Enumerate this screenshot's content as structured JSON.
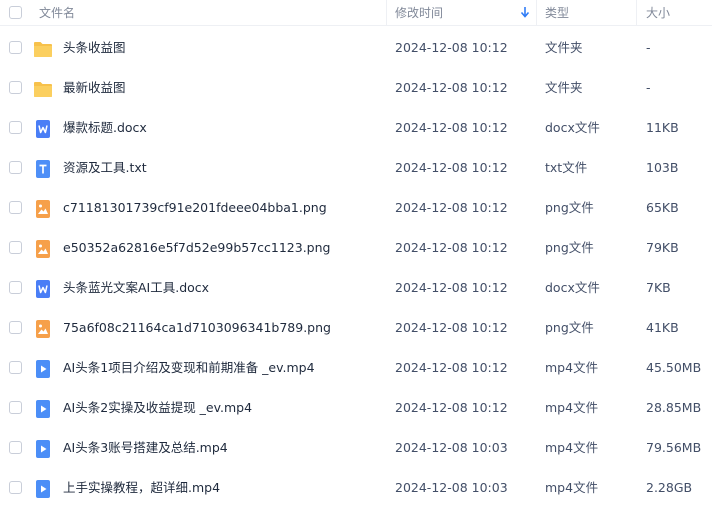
{
  "header": {
    "name": "文件名",
    "time": "修改时间",
    "type": "类型",
    "size": "大小",
    "sort_icon": "arrow-down-icon"
  },
  "colors": {
    "folder": "#f7c14b",
    "word": "#4a7ef6",
    "text": "#4e8ff7",
    "image": "#f6a04a",
    "video": "#4b8ef7",
    "sort_arrow": "#2f7cf6"
  },
  "rows": [
    {
      "icon": "folder-icon",
      "name": "头条收益图",
      "time": "2024-12-08 10:12",
      "type": "文件夹",
      "size": "-"
    },
    {
      "icon": "folder-icon",
      "name": "最新收益图",
      "time": "2024-12-08 10:12",
      "type": "文件夹",
      "size": "-"
    },
    {
      "icon": "word-doc-icon",
      "name": "爆款标题.docx",
      "time": "2024-12-08 10:12",
      "type": "docx文件",
      "size": "11KB"
    },
    {
      "icon": "text-file-icon",
      "name": "资源及工具.txt",
      "time": "2024-12-08 10:12",
      "type": "txt文件",
      "size": "103B"
    },
    {
      "icon": "image-file-icon",
      "name": "c71181301739cf91e201fdeee04bba1.png",
      "time": "2024-12-08 10:12",
      "type": "png文件",
      "size": "65KB"
    },
    {
      "icon": "image-file-icon",
      "name": "e50352a62816e5f7d52e99b57cc1123.png",
      "time": "2024-12-08 10:12",
      "type": "png文件",
      "size": "79KB"
    },
    {
      "icon": "word-doc-icon",
      "name": "头条蓝光文案AI工具.docx",
      "time": "2024-12-08 10:12",
      "type": "docx文件",
      "size": "7KB"
    },
    {
      "icon": "image-file-icon",
      "name": "75a6f08c21164ca1d7103096341b789.png",
      "time": "2024-12-08 10:12",
      "type": "png文件",
      "size": "41KB"
    },
    {
      "icon": "video-file-icon",
      "name": "AI头条1项目介绍及变现和前期准备  _ev.mp4",
      "time": "2024-12-08 10:12",
      "type": "mp4文件",
      "size": "45.50MB"
    },
    {
      "icon": "video-file-icon",
      "name": "AI头条2实操及收益提现  _ev.mp4",
      "time": "2024-12-08 10:12",
      "type": "mp4文件",
      "size": "28.85MB"
    },
    {
      "icon": "video-file-icon",
      "name": "AI头条3账号搭建及总结.mp4",
      "time": "2024-12-08 10:03",
      "type": "mp4文件",
      "size": "79.56MB"
    },
    {
      "icon": "video-file-icon",
      "name": "上手实操教程，超详细.mp4",
      "time": "2024-12-08 10:03",
      "type": "mp4文件",
      "size": "2.28GB"
    }
  ]
}
